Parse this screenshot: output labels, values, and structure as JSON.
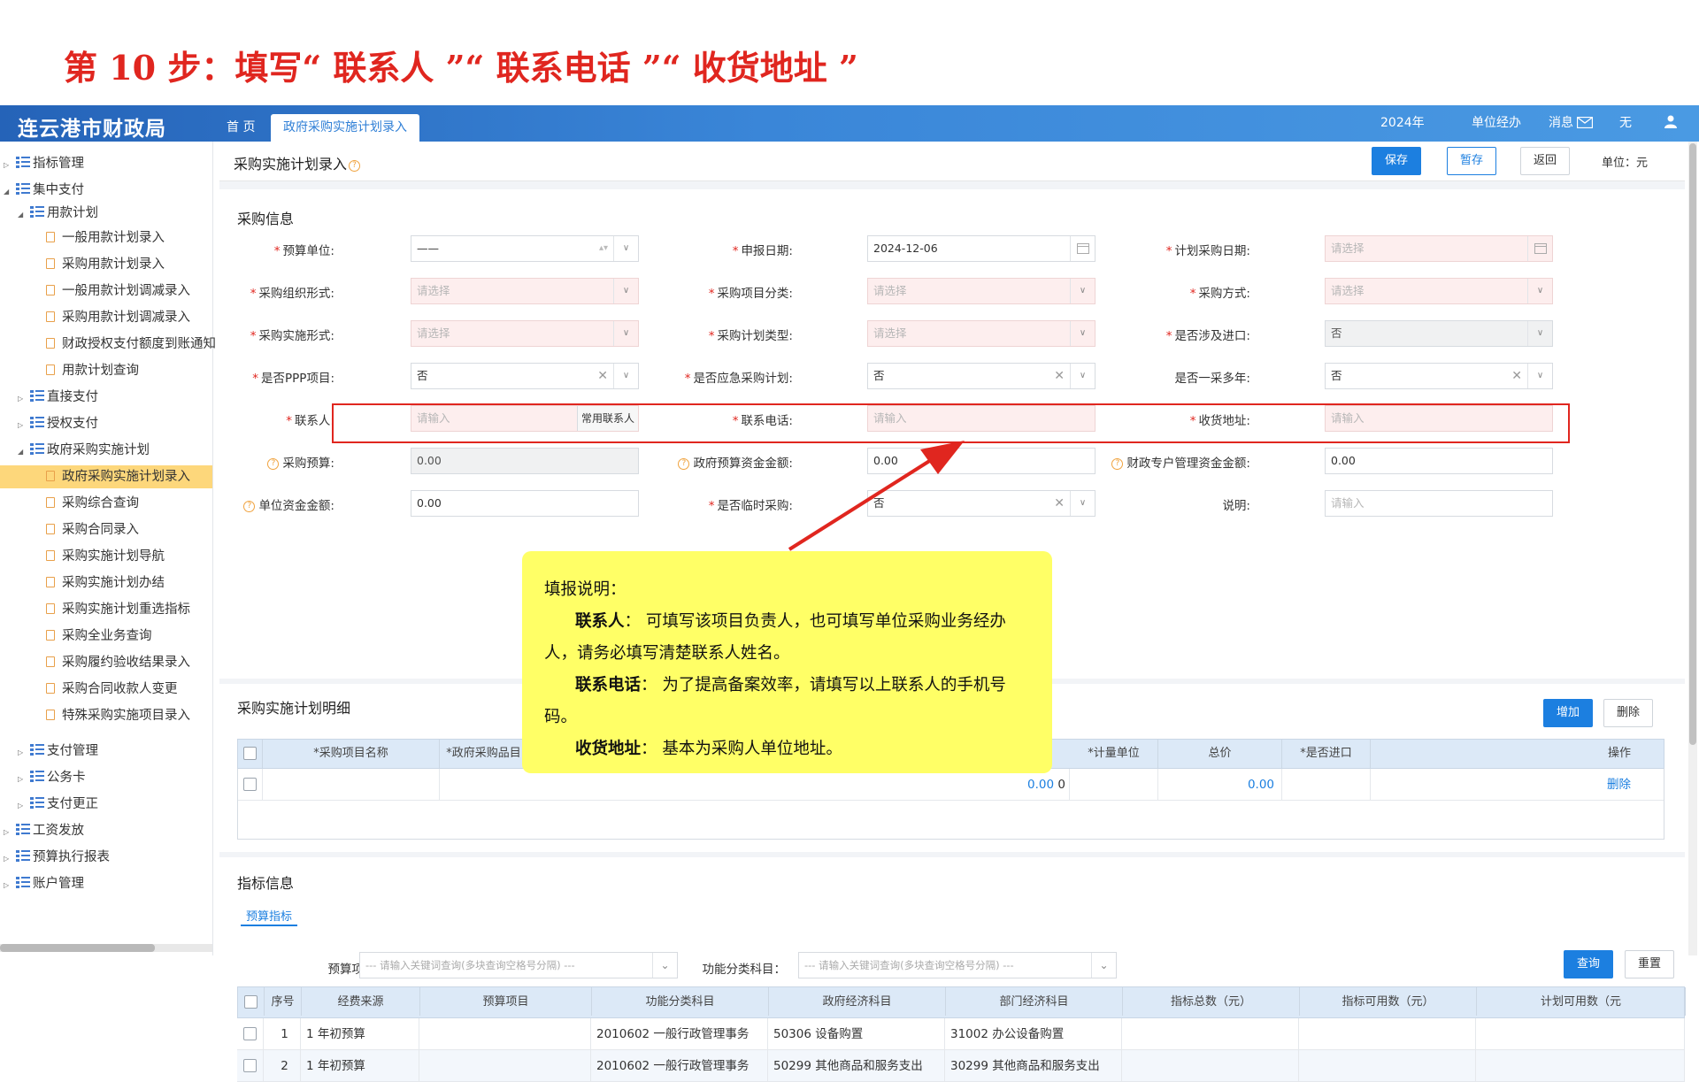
{
  "step_title": "第 10 步：填写“ 联系人 ”“ 联系电话 ”“ 收货地址 ”",
  "app_title": "连云港市财政局",
  "top_tabs": {
    "home": "首 页",
    "active": "政府采购实施计划录入"
  },
  "top_right": {
    "year": "2024年",
    "unit": "单位经办",
    "messages": "消息",
    "none": "无"
  },
  "sidebar": {
    "items": [
      {
        "label": "指标管理",
        "level": 0,
        "expanded": false
      },
      {
        "label": "集中支付",
        "level": 0,
        "expanded": true
      },
      {
        "label": "用款计划",
        "level": 1,
        "expanded": true
      },
      {
        "label": "一般用款计划录入",
        "level": 2
      },
      {
        "label": "采购用款计划录入",
        "level": 2
      },
      {
        "label": "一般用款计划调减录入",
        "level": 2
      },
      {
        "label": "采购用款计划调减录入",
        "level": 2
      },
      {
        "label": "财政授权支付额度到账通知",
        "level": 2
      },
      {
        "label": "用款计划查询",
        "level": 2
      },
      {
        "label": "直接支付",
        "level": 1,
        "expanded": false
      },
      {
        "label": "授权支付",
        "level": 1,
        "expanded": false
      },
      {
        "label": "政府采购实施计划",
        "level": 1,
        "expanded": true
      },
      {
        "label": "政府采购实施计划录入",
        "level": 2,
        "active": true
      },
      {
        "label": "采购综合查询",
        "level": 2
      },
      {
        "label": "采购合同录入",
        "level": 2
      },
      {
        "label": "采购实施计划导航",
        "level": 2
      },
      {
        "label": "采购实施计划办结",
        "level": 2
      },
      {
        "label": "采购实施计划重选指标",
        "level": 2
      },
      {
        "label": "采购全业务查询",
        "level": 2
      },
      {
        "label": "采购履约验收结果录入",
        "level": 2
      },
      {
        "label": "采购合同收款人变更",
        "level": 2
      },
      {
        "label": "特殊采购实施项目录入",
        "level": 2
      },
      {
        "label": "支付管理",
        "level": 1,
        "expanded": false
      },
      {
        "label": "公务卡",
        "level": 1,
        "expanded": false
      },
      {
        "label": "支付更正",
        "level": 1,
        "expanded": false
      },
      {
        "label": "工资发放",
        "level": 0,
        "expanded": false
      },
      {
        "label": "预算执行报表",
        "level": 0,
        "expanded": false
      },
      {
        "label": "账户管理",
        "level": 0,
        "expanded": false
      }
    ]
  },
  "page_header": {
    "title": "采购实施计划录入",
    "save": "保存",
    "draft": "暂存",
    "back": "返回",
    "unit": "单位：元"
  },
  "purchase_info": {
    "title": "采购信息",
    "fields": {
      "budget_unit": {
        "label": "预算单位:",
        "value": "——"
      },
      "report_date": {
        "label": "申报日期:",
        "value": "2024-12-06"
      },
      "plan_date": {
        "label": "计划采购日期:",
        "placeholder": "请选择"
      },
      "org_form": {
        "label": "采购组织形式:",
        "placeholder": "请选择"
      },
      "item_class": {
        "label": "采购项目分类:",
        "placeholder": "请选择"
      },
      "method": {
        "label": "采购方式:",
        "placeholder": "请选择"
      },
      "impl_form": {
        "label": "采购实施形式:",
        "placeholder": "请选择"
      },
      "plan_type": {
        "label": "采购计划类型:",
        "placeholder": "请选择"
      },
      "import": {
        "label": "是否涉及进口:",
        "value": "否"
      },
      "ppp": {
        "label": "是否PPP项目:",
        "value": "否"
      },
      "emergency": {
        "label": "是否应急采购计划:",
        "value": "否"
      },
      "multi_year": {
        "label": "是否一采多年:",
        "value": "否"
      },
      "contact": {
        "label": "联系人:",
        "placeholder": "请输入",
        "button": "常用联系人"
      },
      "phone": {
        "label": "联系电话:",
        "placeholder": "请输入"
      },
      "address": {
        "label": "收货地址:",
        "placeholder": "请输入"
      },
      "budget": {
        "label": "采购预算:",
        "value": "0.00"
      },
      "gov_budget": {
        "label": "政府预算资金金额:",
        "value": "0.00"
      },
      "special_fund": {
        "label": "财政专户管理资金金额:",
        "value": "0.00"
      },
      "unit_fund": {
        "label": "单位资金金额:",
        "value": "0.00"
      },
      "temporary": {
        "label": "是否临时采购:",
        "value": "否"
      },
      "remark": {
        "label": "说明:",
        "placeholder": "请输入"
      }
    }
  },
  "detail": {
    "title": "采购实施计划明细",
    "add": "增加",
    "delete": "删除",
    "columns": [
      "*采购项目名称",
      "*政府采购品目",
      "*计量单位",
      "总价",
      "*是否进口",
      "操作"
    ],
    "row": {
      "amount1": "0.00",
      "amount2": "0",
      "total": "0.00",
      "action": "删除"
    }
  },
  "callout": {
    "heading": "填报说明：",
    "contact_key": "联系人",
    "contact_text": "：  可填写该项目负责人，也可填写单位采购业务经办人，请务必填写清楚联系人姓名。",
    "phone_key": "联系电话",
    "phone_text": "：  为了提高备案效率，请填写以上联系人的手机号码。",
    "address_key": "收货地址",
    "address_text": "：  基本为采购人单位地址。"
  },
  "indicator": {
    "title": "指标信息",
    "tab": "预算指标",
    "budget_item_label": "预算项目：",
    "budget_item_placeholder": "--- 请输入关键词查询(多块查询空格号分隔) ---",
    "func_label": "功能分类科目：",
    "func_placeholder": "--- 请输入关键词查询(多块查询空格号分隔) ---",
    "query": "查询",
    "reset": "重置",
    "columns": [
      "序号",
      "经费来源",
      "预算项目",
      "功能分类科目",
      "政府经济科目",
      "部门经济科目",
      "指标总数（元）",
      "指标可用数（元）",
      "计划可用数（元"
    ],
    "rows": [
      {
        "no": "1",
        "source": "1 年初预算",
        "func": "2010602 一般行政管理事务",
        "gov": "50306 设备购置",
        "dept": "31002 办公设备购置"
      },
      {
        "no": "2",
        "source": "1 年初预算",
        "func": "2010602 一般行政管理事务",
        "gov": "50299 其他商品和服务支出",
        "dept": "30299 其他商品和服务支出"
      }
    ]
  }
}
